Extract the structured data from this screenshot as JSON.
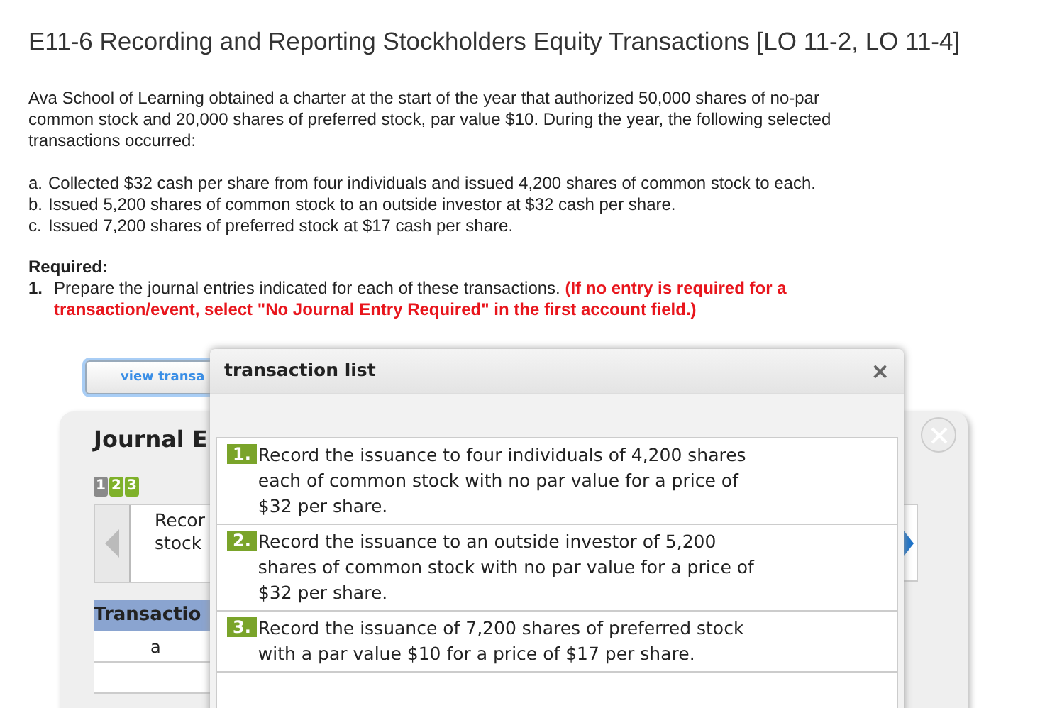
{
  "title": "E11-6 Recording and Reporting Stockholders Equity Transactions [LO 11-2, LO 11-4]",
  "intro": "Ava School of Learning obtained a charter at the start of the year that authorized 50,000 shares of no-par common stock and 20,000 shares of preferred stock, par value $10. During the year, the following selected transactions occurred:",
  "transactions": [
    {
      "marker": "a.",
      "text": "Collected $32 cash per share from four individuals and issued 4,200 shares of common stock to each."
    },
    {
      "marker": "b.",
      "text": "Issued 5,200 shares of common stock to an outside investor at $32 cash per share."
    },
    {
      "marker": "c.",
      "text": "Issued 7,200 shares of preferred stock at $17 cash per share."
    }
  ],
  "required": {
    "heading": "Required:",
    "items": [
      {
        "marker": "1.",
        "text": "Prepare the journal entries indicated for each of these transactions. **(If no entry is required for a transaction/event, select \"No Journal Entry Required\" in the first account field.)**"
      }
    ]
  },
  "view_button": "view transa",
  "widget": {
    "title": "Journal E",
    "steps": [
      {
        "label": "1",
        "selected": true
      },
      {
        "label": "2",
        "selected": false
      },
      {
        "label": "3",
        "selected": false
      }
    ],
    "description_lines": [
      "Recor",
      "stock"
    ],
    "table": {
      "header": "Transactio",
      "rows": [
        "a"
      ]
    }
  },
  "dialog": {
    "title": "transaction list",
    "close": "×",
    "items": [
      {
        "number": "1.",
        "text": "Record the issuance to four individuals of 4,200 shares each of common stock with no par value for a price of $32 per share."
      },
      {
        "number": "2.",
        "text": "Record the issuance to an outside investor of 5,200 shares of common stock with no par value for a price of $32 per share."
      },
      {
        "number": "3.",
        "text": "Record the issuance of 7,200 shares of preferred stock with a par value $10 for a price of $17 per share."
      }
    ]
  }
}
